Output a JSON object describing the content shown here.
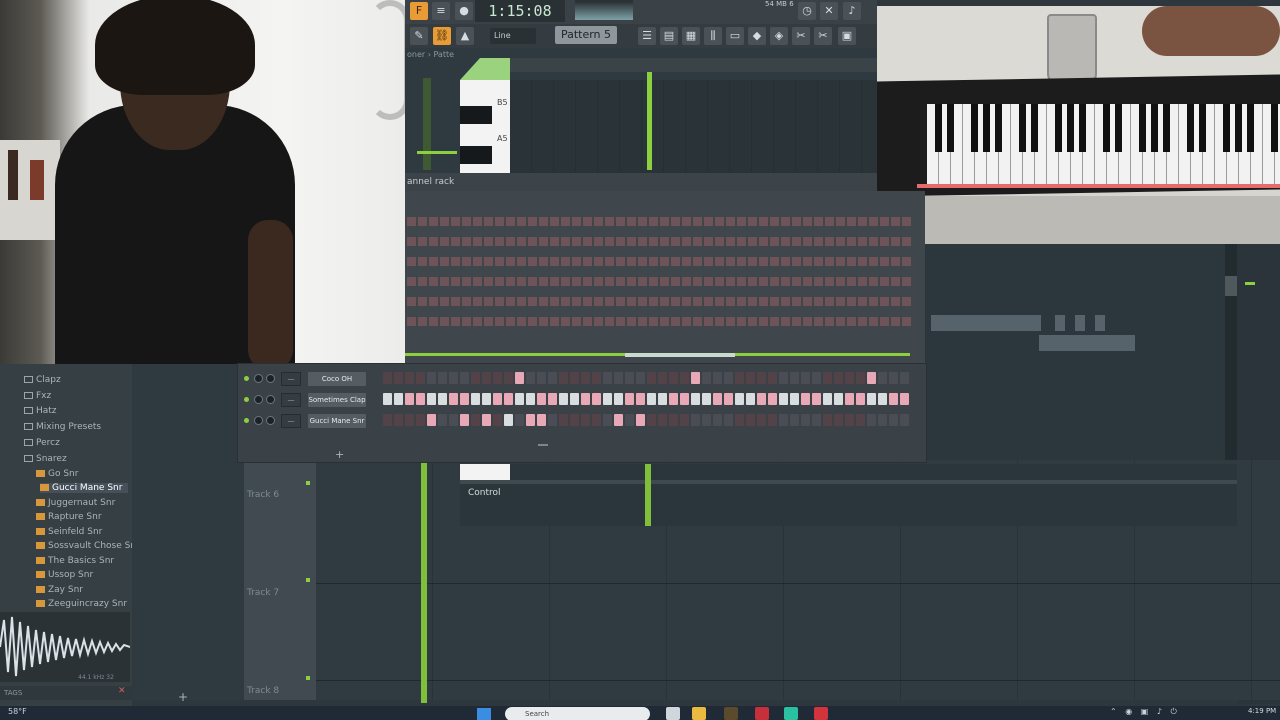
{
  "toolbar": {
    "time": "1:15:08",
    "cpu": "54 MB 6",
    "snap_mode": "Line",
    "pattern": "Pattern 5"
  },
  "piano_roll": {
    "title": "oner › Patte",
    "key_labels": [
      "B5",
      "A5"
    ]
  },
  "channel_rack": {
    "title": "annel rack",
    "channels": [
      {
        "name": "Coco OH",
        "steps": [
          0,
          0,
          0,
          0,
          0,
          0,
          0,
          0,
          0,
          0,
          0,
          0,
          1,
          0,
          0,
          0,
          0,
          0,
          0,
          0,
          0,
          0,
          0,
          0,
          0,
          0,
          0,
          0,
          1,
          0,
          0,
          0,
          0,
          0,
          0,
          0,
          0,
          0,
          0,
          0,
          0,
          0,
          0,
          0,
          1,
          0,
          0,
          0
        ]
      },
      {
        "name": "Sometimes Clap",
        "steps": [
          2,
          2,
          1,
          1,
          2,
          2,
          1,
          1,
          2,
          2,
          1,
          1,
          2,
          2,
          1,
          1,
          2,
          2,
          1,
          1,
          2,
          2,
          1,
          1,
          2,
          2,
          1,
          1,
          2,
          2,
          1,
          1,
          2,
          2,
          1,
          1,
          2,
          2,
          1,
          1,
          2,
          2,
          1,
          1,
          2,
          2,
          1,
          1
        ]
      },
      {
        "name": "Gucci Mane Snr",
        "steps": [
          0,
          0,
          0,
          0,
          1,
          0,
          0,
          1,
          0,
          1,
          0,
          2,
          0,
          1,
          1,
          0,
          0,
          0,
          0,
          0,
          0,
          1,
          0,
          1,
          0,
          0,
          0,
          0,
          0,
          0,
          0,
          0,
          0,
          0,
          0,
          0,
          0,
          0,
          0,
          0,
          0,
          0,
          0,
          0,
          0,
          0,
          0,
          0
        ]
      }
    ],
    "add_label": "+"
  },
  "browser": {
    "items": [
      {
        "label": "Clapz",
        "type": "folder"
      },
      {
        "label": "Fxz",
        "type": "folder"
      },
      {
        "label": "Hatz",
        "type": "folder"
      },
      {
        "label": "Mixing Presets",
        "type": "folder"
      },
      {
        "label": "Percz",
        "type": "folder"
      },
      {
        "label": "Snarez",
        "type": "folder"
      },
      {
        "label": "Go Snr",
        "type": "snr"
      },
      {
        "label": "Gucci Mane Snr",
        "type": "snr"
      },
      {
        "label": "Juggernaut Snr",
        "type": "snr"
      },
      {
        "label": "Rapture Snr",
        "type": "snr"
      },
      {
        "label": "Seinfeld Snr",
        "type": "snr"
      },
      {
        "label": "Sossvault Chose Snr",
        "type": "snr"
      },
      {
        "label": "The Basics Snr",
        "type": "snr"
      },
      {
        "label": "Ussop Snr",
        "type": "snr"
      },
      {
        "label": "Zay Snr",
        "type": "snr"
      },
      {
        "label": "Zeeguincrazy Snr",
        "type": "snr"
      }
    ],
    "wave_info": "44.1 kHz 32",
    "tags_label": "TAGS"
  },
  "playlist": {
    "tracks": [
      "Track 6",
      "Track 7",
      "Track 8"
    ],
    "add_label": "+"
  },
  "control_label": "Control",
  "taskbar": {
    "weather": "58°F",
    "search_placeholder": "Search",
    "time": "4:19 PM"
  }
}
